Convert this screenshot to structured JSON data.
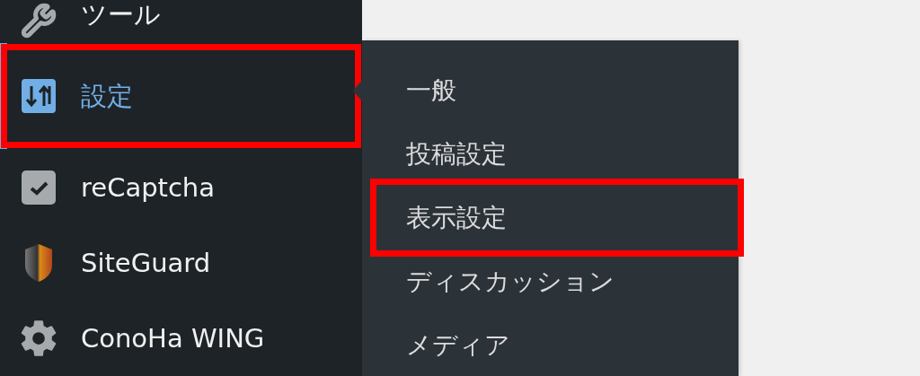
{
  "sidebar": {
    "items": [
      {
        "label": "ツール",
        "selected": false,
        "highlighted": false
      },
      {
        "label": "設定",
        "selected": true,
        "highlighted": true
      },
      {
        "label": "reCaptcha",
        "selected": false,
        "highlighted": false
      },
      {
        "label": "SiteGuard",
        "selected": false,
        "highlighted": false
      },
      {
        "label": "ConoHa WING",
        "selected": false,
        "highlighted": false
      }
    ]
  },
  "submenu": {
    "items": [
      {
        "label": "一般",
        "highlighted": false
      },
      {
        "label": "投稿設定",
        "highlighted": false
      },
      {
        "label": "表示設定",
        "highlighted": true
      },
      {
        "label": "ディスカッション",
        "highlighted": false
      },
      {
        "label": "メディア",
        "highlighted": false
      }
    ]
  }
}
